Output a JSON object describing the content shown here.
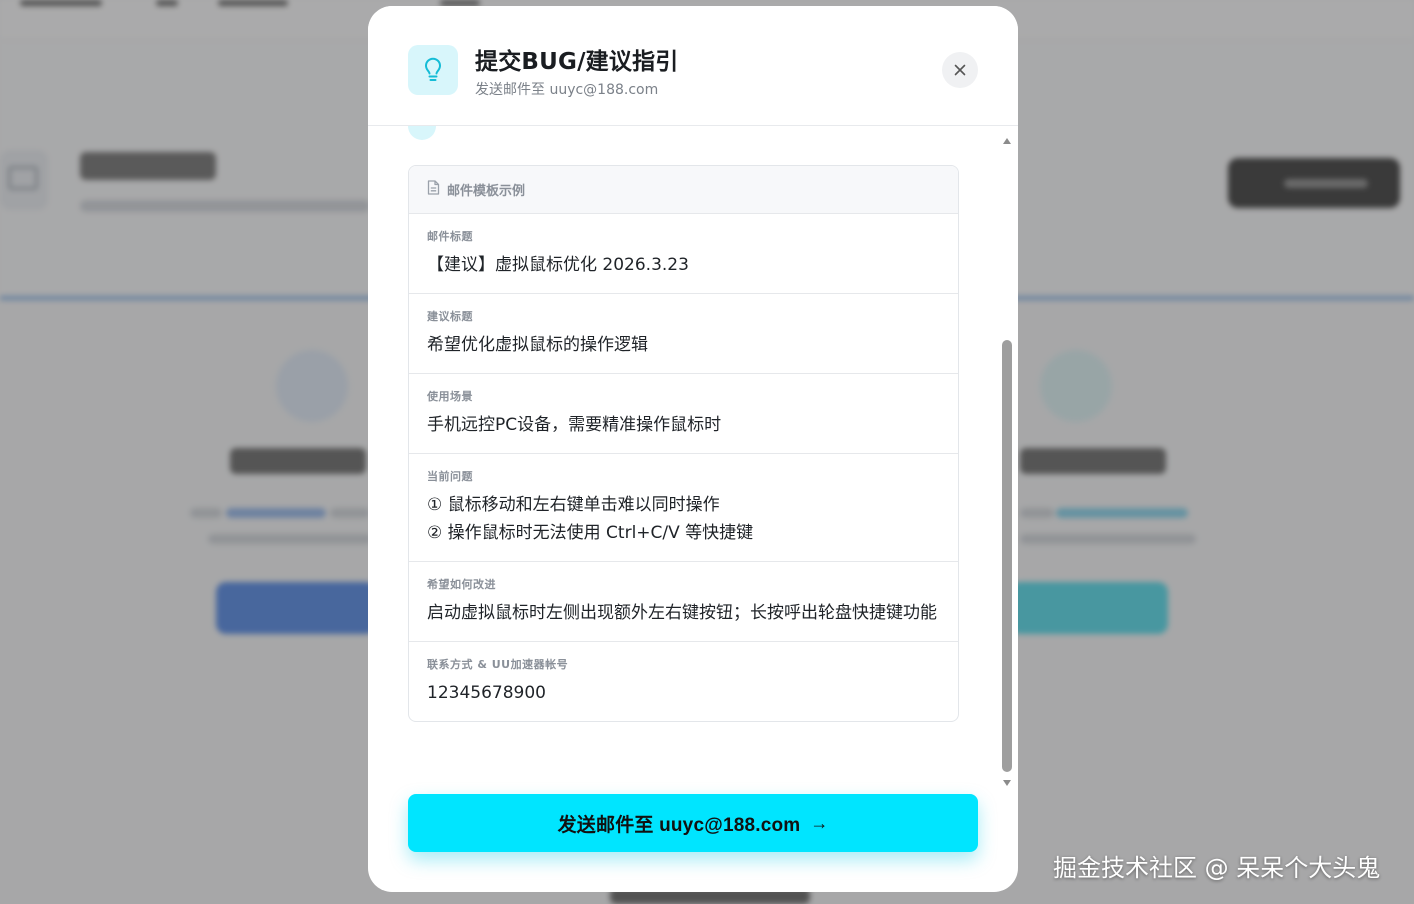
{
  "modal": {
    "title": "提交BUG/建议指引",
    "subtitle": "发送邮件至 uuyc@188.com",
    "icon": "lightbulb-icon",
    "close_icon": "close-icon",
    "accent_color": "#00e5ff",
    "icon_bg_color": "#d8f6fb"
  },
  "template": {
    "header_icon": "document-icon",
    "header_label": "邮件模板示例",
    "fields": [
      {
        "label": "邮件标题",
        "lines": [
          "【建议】虚拟鼠标优化 2026.3.23"
        ]
      },
      {
        "label": "建议标题",
        "lines": [
          "希望优化虚拟鼠标的操作逻辑"
        ]
      },
      {
        "label": "使用场景",
        "lines": [
          "手机远控PC设备，需要精准操作鼠标时"
        ]
      },
      {
        "label": "当前问题",
        "lines": [
          "① 鼠标移动和左右键单击难以同时操作",
          "② 操作鼠标时无法使用 Ctrl+C/V 等快捷键"
        ]
      },
      {
        "label": "希望如何改进",
        "lines": [
          "启动虚拟鼠标时左侧出现额外左右键按钮；长按呼出轮盘快捷键功能"
        ]
      },
      {
        "label": "联系方式 & UU加速器帐号",
        "lines": [
          "12345678900"
        ]
      }
    ]
  },
  "send_button": {
    "label": "发送邮件至 uuyc@188.com",
    "arrow": "→",
    "icon": "arrow-right-icon"
  },
  "watermark": "掘金技术社区 @ 呆呆个大头鬼"
}
